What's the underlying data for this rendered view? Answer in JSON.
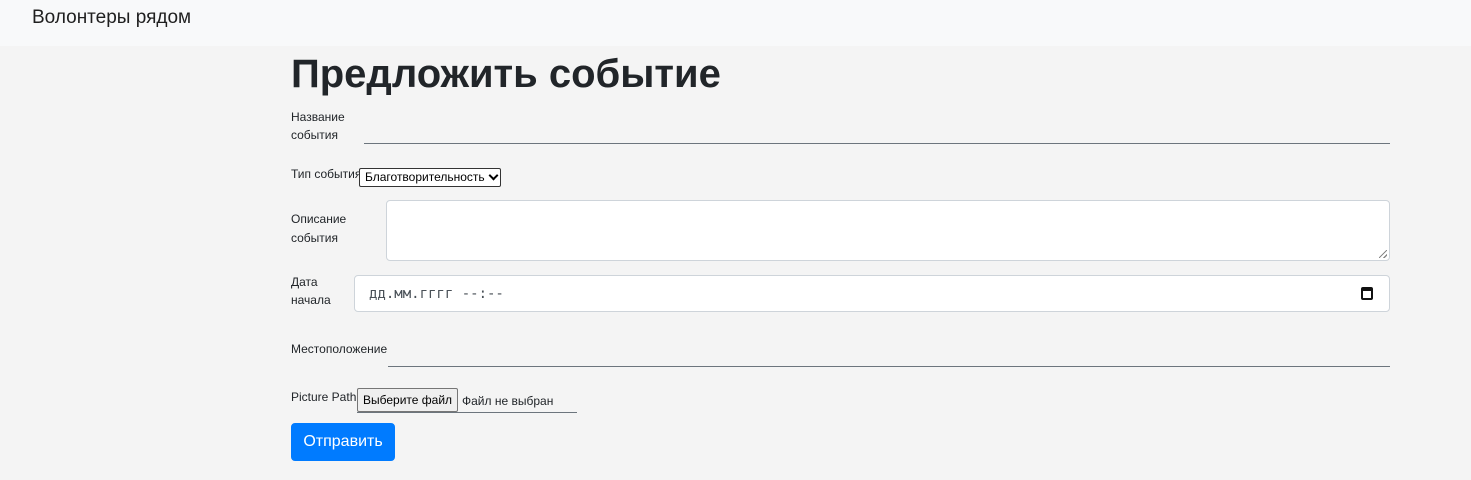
{
  "navbar": {
    "brand": "Волонтеры рядом"
  },
  "page": {
    "title": "Предложить событие"
  },
  "form": {
    "name": {
      "label_line1": "Название",
      "label_line2": "события",
      "value": ""
    },
    "type": {
      "label": "Тип события",
      "selected": "Благотворительность"
    },
    "description": {
      "label_line1": "Описание",
      "label_line2": "события",
      "value": ""
    },
    "start_date": {
      "label_line1": "Дата",
      "label_line2": "начала",
      "placeholder": "дд.мм.гггг --:--"
    },
    "location": {
      "label": "Местоположение",
      "value": ""
    },
    "picture": {
      "label": "Picture Path.",
      "button_label": "Выберите файл",
      "status": "Файл не выбран"
    },
    "submit_label": "Отправить"
  },
  "colors": {
    "background": "#f4f4f4",
    "navbar": "#f8f9fa",
    "primary": "#007bff"
  },
  "icons": {
    "date": "calendar-icon",
    "select": "chevron-down-icon"
  }
}
